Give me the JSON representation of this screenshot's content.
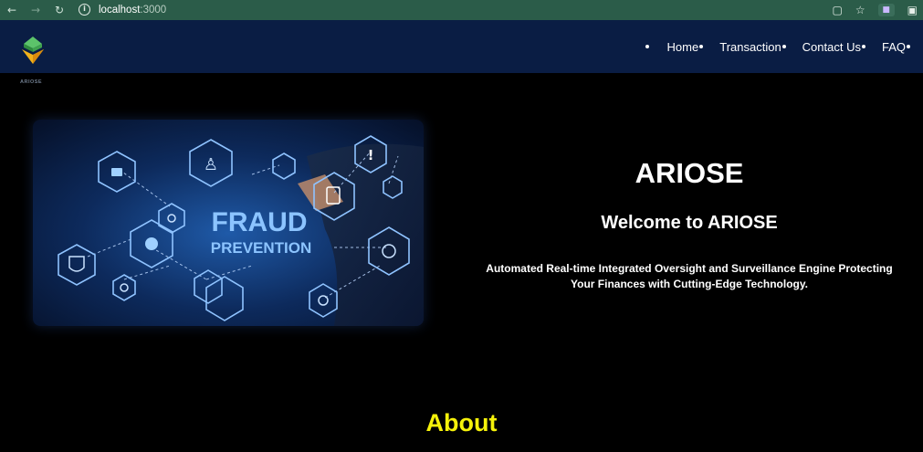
{
  "browser": {
    "url_host": "localhost",
    "url_port": ":3000"
  },
  "brand": {
    "name": "ARIOSE",
    "logo_colors": [
      "#2e8b3e",
      "#5cc36a",
      "#f2b21b",
      "#d98b0d"
    ]
  },
  "nav": {
    "items": [
      {
        "label": "Home"
      },
      {
        "label": "Transaction"
      },
      {
        "label": "Contact Us"
      },
      {
        "label": "FAQ"
      }
    ]
  },
  "hero": {
    "image_text_1": "FRAUD",
    "image_text_2": "PREVENTION",
    "title": "ARIOSE",
    "subtitle": "Welcome to ARIOSE",
    "description_line1": "Automated Real-time Integrated Oversight and Surveillance Engine Protecting",
    "description_line2": "Your Finances with Cutting-Edge Technology."
  },
  "sections": {
    "about_heading": "About"
  },
  "colors": {
    "header_bg": "#0a1d44",
    "page_bg": "#000000",
    "chrome_bg": "#2b5c49",
    "about_heading": "#f5f10a"
  }
}
